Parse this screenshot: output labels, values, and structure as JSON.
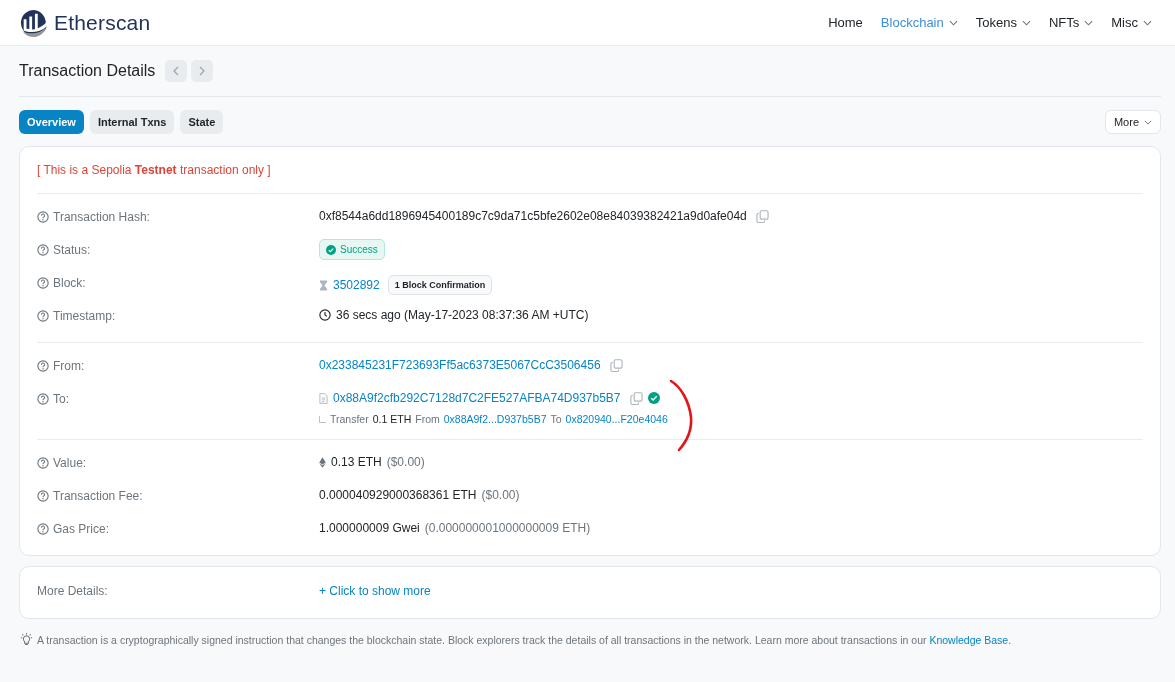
{
  "header": {
    "brand": "Etherscan",
    "nav": [
      {
        "label": "Home",
        "selected": false,
        "dropdown": false
      },
      {
        "label": "Blockchain",
        "selected": true,
        "dropdown": true
      },
      {
        "label": "Tokens",
        "selected": false,
        "dropdown": true
      },
      {
        "label": "NFTs",
        "selected": false,
        "dropdown": true
      },
      {
        "label": "Misc",
        "selected": false,
        "dropdown": true
      }
    ]
  },
  "page_title": "Transaction Details",
  "tabs": [
    {
      "label": "Overview",
      "selected": true
    },
    {
      "label": "Internal Txns",
      "selected": false
    },
    {
      "label": "State",
      "selected": false
    }
  ],
  "more_button": "More",
  "notice": {
    "before": "[ This is a Sepolia ",
    "strong": "Testnet",
    "after": " transaction only ]"
  },
  "groups": [
    [
      {
        "kind": "hash",
        "label": "Transaction Hash:",
        "value": "0xf8544a6dd1896945400189c7c9da71c5bfe2602e08e84039382421a9d0afe04d"
      },
      {
        "kind": "status",
        "label": "Status:",
        "value": "Success"
      },
      {
        "kind": "block",
        "label": "Block:",
        "value": "3502892",
        "confirmation": "1 Block Confirmation"
      },
      {
        "kind": "time",
        "label": "Timestamp:",
        "value": "36 secs ago (May-17-2023 08:37:36 AM +UTC)"
      }
    ],
    [
      {
        "kind": "address",
        "label": "From:",
        "value": "0x233845231F723693Ff5ac6373E5067CcC3506456"
      },
      {
        "kind": "contract",
        "label": "To:",
        "value": "0x88A9f2cfb292C7128d7C2FE527AFBA74D937b5B7",
        "verified": true,
        "transfer": {
          "word": "Transfer",
          "amount": "0.1 ETH",
          "from_word": "From",
          "from": "0x88A9f2...D937b5B7",
          "to_word": "To",
          "to": "0x820940...F20e4046"
        }
      }
    ],
    [
      {
        "kind": "eth",
        "label": "Value:",
        "value": "0.13 ETH",
        "note": "($0.00)"
      },
      {
        "kind": "amount",
        "label": "Transaction Fee:",
        "value": "0.000040929000368361 ETH",
        "note": "($0.00)"
      },
      {
        "kind": "amount",
        "label": "Gas Price:",
        "value": "1.000000009 Gwei",
        "note": "(0.000000001000000009 ETH)"
      }
    ]
  ],
  "more_details": {
    "label": "More Details:",
    "link": "+ Click to show more"
  },
  "footer": {
    "text": "A transaction is a cryptographically signed instruction that changes the blockchain state. Block explorers track the details of all transactions in the network. Learn more about transactions in our ",
    "link": "Knowledge Base",
    "end": "."
  }
}
